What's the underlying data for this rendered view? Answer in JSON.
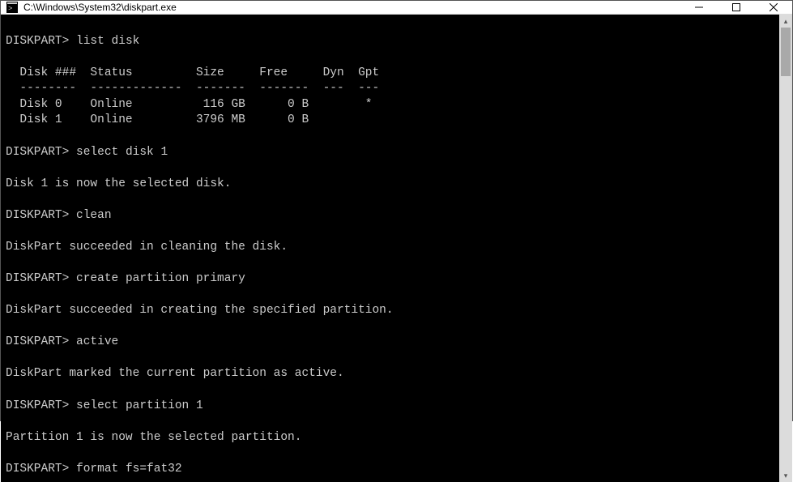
{
  "window": {
    "title": "C:\\Windows\\System32\\diskpart.exe"
  },
  "terminal": {
    "prompt": "DISKPART>",
    "lines": {
      "cmd1": "list disk",
      "header": "  Disk ###  Status         Size     Free     Dyn  Gpt",
      "divider": "  --------  -------------  -------  -------  ---  ---",
      "row0": "  Disk 0    Online          116 GB      0 B        *",
      "row1": "  Disk 1    Online         3796 MB      0 B",
      "cmd2": "select disk 1",
      "resp2": "Disk 1 is now the selected disk.",
      "cmd3": "clean",
      "resp3": "DiskPart succeeded in cleaning the disk.",
      "cmd4": "create partition primary",
      "resp4": "DiskPart succeeded in creating the specified partition.",
      "cmd5": "active",
      "resp5": "DiskPart marked the current partition as active.",
      "cmd6": "select partition 1",
      "resp6": "Partition 1 is now the selected partition.",
      "cmd7": "format fs=fat32"
    }
  }
}
